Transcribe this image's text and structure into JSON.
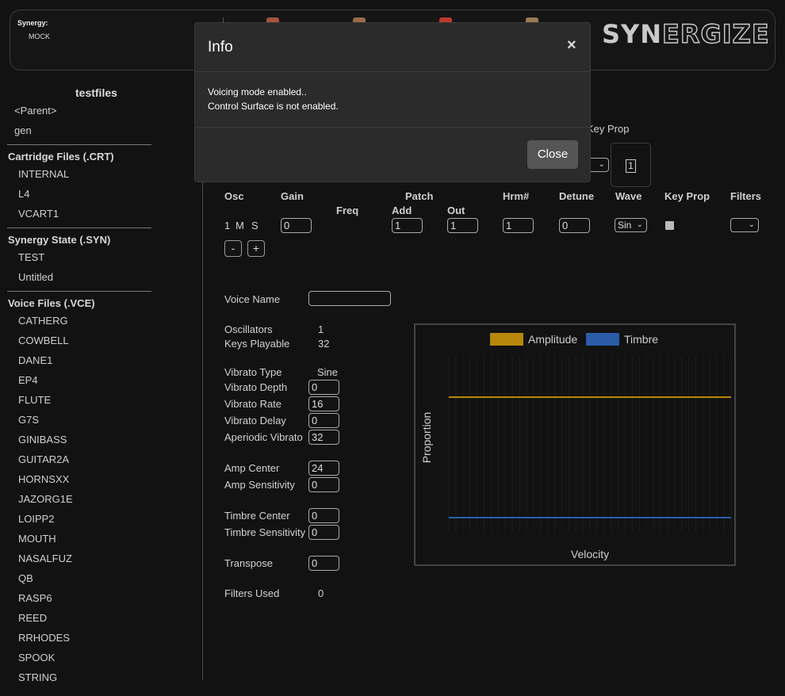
{
  "header": {
    "synergy_label": "Synergy:",
    "synergy_mode": "MOCK",
    "logo_left": "SYN",
    "logo_right": "ERGIZE"
  },
  "sidebar": {
    "title": "testfiles",
    "nav": [
      "<Parent>",
      "gen"
    ],
    "sections": [
      {
        "title": "Cartridge Files (.CRT)",
        "items": [
          "INTERNAL",
          "L4",
          "VCART1"
        ]
      },
      {
        "title": "Synergy State (.SYN)",
        "items": [
          "TEST",
          "Untitled"
        ]
      },
      {
        "title": "Voice Files (.VCE)",
        "items": [
          "CATHERG",
          "COWBELL",
          "DANE1",
          "EP4",
          "FLUTE",
          "G7S",
          "GINIBASS",
          "GUITAR2A",
          "HORNSXX",
          "JAZORG1E",
          "LOIPP2",
          "MOUTH",
          "NASALFUZ",
          "QB",
          "RASP6",
          "REED",
          "RRHODES",
          "SPOOK",
          "STRING"
        ]
      }
    ]
  },
  "partial_top": {
    "key_prop_label": "Key Prop",
    "key_prop_value": "1"
  },
  "osc_table": {
    "headers": {
      "osc": "Osc",
      "gain": "Gain",
      "patch": "Patch",
      "freq": "Freq",
      "add": "Add",
      "out": "Out",
      "hrm": "Hrm#",
      "detune": "Detune",
      "wave": "Wave",
      "keyprop": "Key Prop",
      "filters": "Filters"
    },
    "row": {
      "num": "1",
      "m": "M",
      "s": "S",
      "gain": "0",
      "add": "1",
      "out": "1",
      "hrm": "1",
      "detune": "0",
      "wave": "Sin",
      "filters": ""
    },
    "minus": "-",
    "plus": "+"
  },
  "voice": {
    "name_label": "Voice Name",
    "name_value": "",
    "oscillators_label": "Oscillators",
    "oscillators_value": "1",
    "keys_label": "Keys Playable",
    "keys_value": "32",
    "vibrato_type_label": "Vibrato Type",
    "vibrato_type_value": "Sine",
    "vibrato_depth_label": "Vibrato Depth",
    "vibrato_depth_value": "0",
    "vibrato_rate_label": "Vibrato Rate",
    "vibrato_rate_value": "16",
    "vibrato_delay_label": "Vibrato Delay",
    "vibrato_delay_value": "0",
    "aperiodic_label": "Aperiodic Vibrato",
    "aperiodic_value": "32",
    "amp_center_label": "Amp Center",
    "amp_center_value": "24",
    "amp_sens_label": "Amp Sensitivity",
    "amp_sens_value": "0",
    "timbre_center_label": "Timbre Center",
    "timbre_center_value": "0",
    "timbre_sens_label": "Timbre Sensitivity",
    "timbre_sens_value": "0",
    "transpose_label": "Transpose",
    "transpose_value": "0",
    "filters_used_label": "Filters Used",
    "filters_used_value": "0"
  },
  "chart_data": {
    "type": "line",
    "xlabel": "Velocity",
    "ylabel": "Proportion",
    "legend_position": "top-center",
    "series": [
      {
        "name": "Amplitude",
        "color": "#b8860b",
        "level": 0.75
      },
      {
        "name": "Timbre",
        "color": "#2a5caa",
        "level": 0.0
      }
    ],
    "grid": true
  },
  "modal": {
    "title": "Info",
    "close_x": "×",
    "lines": [
      "Voicing mode enabled..",
      "Control Surface is not enabled."
    ],
    "close_button": "Close"
  },
  "colors": {
    "background": "#121212",
    "modal_bg": "#2b2b2b",
    "amplitude": "#b8860b",
    "timbre": "#2a5caa"
  }
}
